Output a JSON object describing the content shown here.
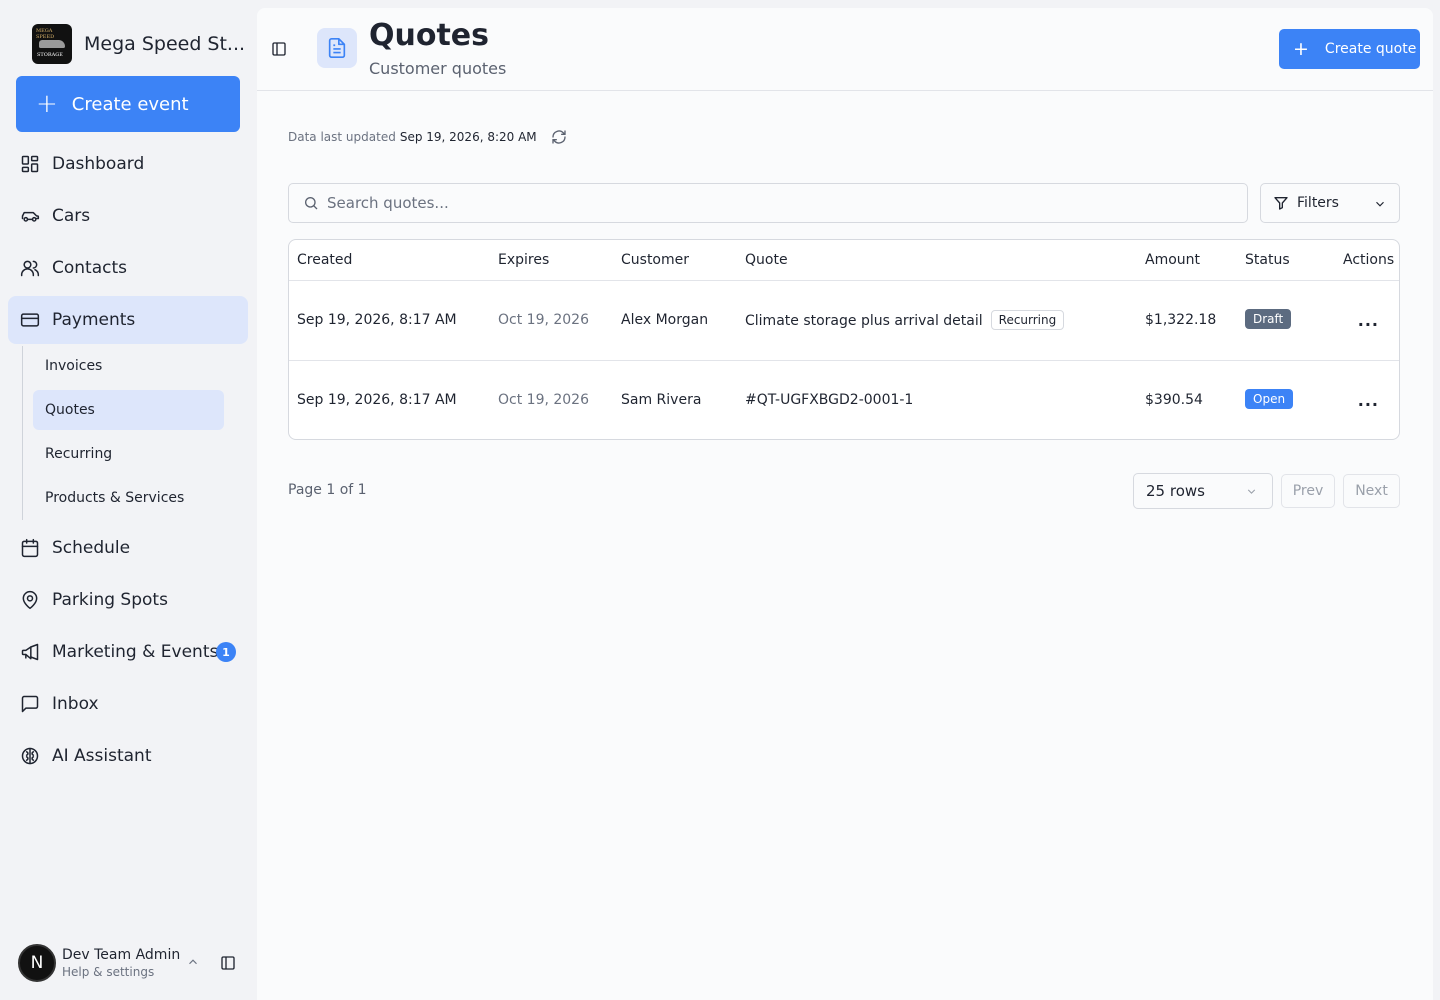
{
  "sidebar": {
    "brand_name": "Mega Speed St...",
    "brand_logo_top": "MEGA SPEED",
    "brand_logo_bottom": "STORAGE",
    "create_event_label": "Create event",
    "items": [
      {
        "label": "Dashboard",
        "icon": "dashboard-icon"
      },
      {
        "label": "Cars",
        "icon": "car-icon"
      },
      {
        "label": "Contacts",
        "icon": "contacts-icon"
      },
      {
        "label": "Payments",
        "icon": "credit-card-icon"
      },
      {
        "label": "Schedule",
        "icon": "calendar-icon"
      },
      {
        "label": "Parking Spots",
        "icon": "map-pin-icon"
      },
      {
        "label": "Marketing & Events",
        "icon": "megaphone-icon",
        "badge": "1"
      },
      {
        "label": "Inbox",
        "icon": "message-square-icon"
      },
      {
        "label": "AI Assistant",
        "icon": "brain-icon"
      }
    ],
    "payments_sub": [
      "Invoices",
      "Quotes",
      "Recurring",
      "Products & Services"
    ],
    "user": {
      "initial": "N",
      "name": "Dev Team Admin",
      "sub": "Help & settings"
    }
  },
  "header": {
    "title": "Quotes",
    "subtitle": "Customer quotes",
    "create_label": "Create quote"
  },
  "updated": {
    "label": "Data last updated",
    "timestamp": "Sep 19, 2026, 8:20 AM"
  },
  "search": {
    "placeholder": "Search quotes..."
  },
  "filters_label": "Filters",
  "table": {
    "columns": [
      "Created",
      "Expires",
      "Customer",
      "Quote",
      "Amount",
      "Status",
      "Actions"
    ],
    "rows": [
      {
        "created": "Sep 19, 2026, 8:17 AM",
        "expires": "Oct 19, 2026",
        "customer": "Alex Morgan",
        "quote": "Climate storage plus arrival detail",
        "tag": "Recurring",
        "amount": "$1,322.18",
        "status": "Draft",
        "actions": "..."
      },
      {
        "created": "Sep 19, 2026, 8:17 AM",
        "expires": "Oct 19, 2026",
        "customer": "Sam Rivera",
        "quote": "#QT-UGFXBGD2-0001-1",
        "amount": "$390.54",
        "status": "Open",
        "actions": "..."
      }
    ]
  },
  "pagination": {
    "page_info": "Page 1 of 1",
    "rows_label": "25 rows",
    "prev": "Prev",
    "next": "Next"
  },
  "colors": {
    "accent": "#3c83f6",
    "active_bg": "#dde6fb",
    "draft": "#5c6b80",
    "open": "#3c83f6"
  }
}
